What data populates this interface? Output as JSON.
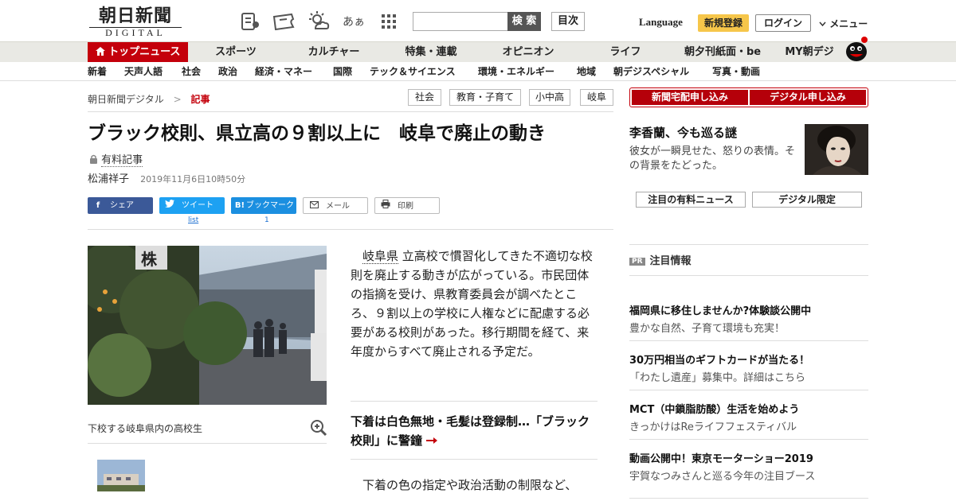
{
  "header": {
    "logo_main": "朝日新聞",
    "logo_sub": "DIGITAL",
    "search_placeholder": "",
    "search_label": "検 索",
    "toc_label": "目次",
    "language_label": "Language",
    "signup_label": "新規登録",
    "login_label": "ログイン",
    "menu_label": "メニュー",
    "font_icon_label": "あぁ"
  },
  "mainnav": {
    "items": [
      {
        "label": "トップニュース"
      },
      {
        "label": "スポーツ"
      },
      {
        "label": "カルチャー"
      },
      {
        "label": "特集・連載"
      },
      {
        "label": "オピニオン"
      },
      {
        "label": "ライフ"
      },
      {
        "label": "朝夕刊紙面・be"
      },
      {
        "label": "MY朝デジ"
      }
    ]
  },
  "subnav": {
    "items": [
      {
        "label": "新着"
      },
      {
        "label": "天声人語"
      },
      {
        "label": "社会"
      },
      {
        "label": "政治"
      },
      {
        "label": "経済・マネー"
      },
      {
        "label": "国際"
      },
      {
        "label": "テック＆サイエンス"
      },
      {
        "label": "環境・エネルギー"
      },
      {
        "label": "地域"
      },
      {
        "label": "朝デジスペシャル"
      },
      {
        "label": "写真・動画"
      }
    ]
  },
  "breadcrumb": {
    "home": "朝日新聞デジタル",
    "separator": ">",
    "current": "記事"
  },
  "tags": [
    {
      "label": "社会"
    },
    {
      "label": "教育・子育て"
    },
    {
      "label": "小中高"
    },
    {
      "label": "岐阜"
    }
  ],
  "article": {
    "headline": "ブラック校則、県立高の９割以上に　岐阜で廃止の動き",
    "paid_label": "有料記事",
    "author": "松浦祥子",
    "date": "2019年11月6日10時50分",
    "share": {
      "facebook": "シェア",
      "twitter": "ツイート",
      "twitter_count": "list",
      "hatena": "ブックマーク",
      "hatena_count": "1",
      "mail": "メール",
      "print": "印刷"
    },
    "photo_caption": "下校する岐阜県内の高校生",
    "body_kw": "岐阜県",
    "body_rest": "立高校で慣習化してきた不適切な校則を廃止する動きが広がっている。市民団体の指摘を受け、県教育委員会が調べたところ、９割以上の学校に人権などに配慮する必要がある校則があった。移行期間を経て、来年度からすべて廃止される予定だ。",
    "related_link": "下着は白色無地・毛髪は登録制…「ブラック校則」に警鐘",
    "body2": "下着の色の指定や政治活動の制限など、"
  },
  "sidebar": {
    "apply_home": "新聞宅配申し込み",
    "apply_digital": "デジタル申し込み",
    "promo_title": "李香蘭、今も巡る謎",
    "promo_desc": "彼女が一瞬見せた、怒りの表情。その背景をたどった。",
    "btn_paid_news": "注目の有料ニュース",
    "btn_digital_only": "デジタル限定",
    "pr_badge": "PR",
    "pr_heading": "注目情報",
    "ads": [
      {
        "title": "福岡県に移住しませんか?体験談公開中",
        "desc": "豊かな自然、子育て環境も充実！"
      },
      {
        "title": "30万円相当のギフトカードが当たる！",
        "desc": "「わたし遺産」募集中。詳細はこちら"
      },
      {
        "title": "MCT（中鎖脂肪酸）生活を始めよう",
        "desc": "きっかけはReライフフェスティバル"
      },
      {
        "title": "動画公開中！東京モーターショー2019",
        "desc": "宇賀なつみさんと巡る今年の注目ブース"
      }
    ]
  },
  "colors": {
    "brand_red": "#c4000b",
    "signup_yellow": "#f6c64a",
    "nav_bg": "#e9e9e4",
    "facebook_blue": "#3b5998",
    "twitter_blue": "#1da1f2"
  },
  "icons": [
    "reader-icon",
    "ticket-icon",
    "weather-icon",
    "font-size-icon",
    "grid-menu-icon",
    "home-icon",
    "lock-icon",
    "zoom-in-icon",
    "chevron-down-icon",
    "arrow-right-icon"
  ]
}
